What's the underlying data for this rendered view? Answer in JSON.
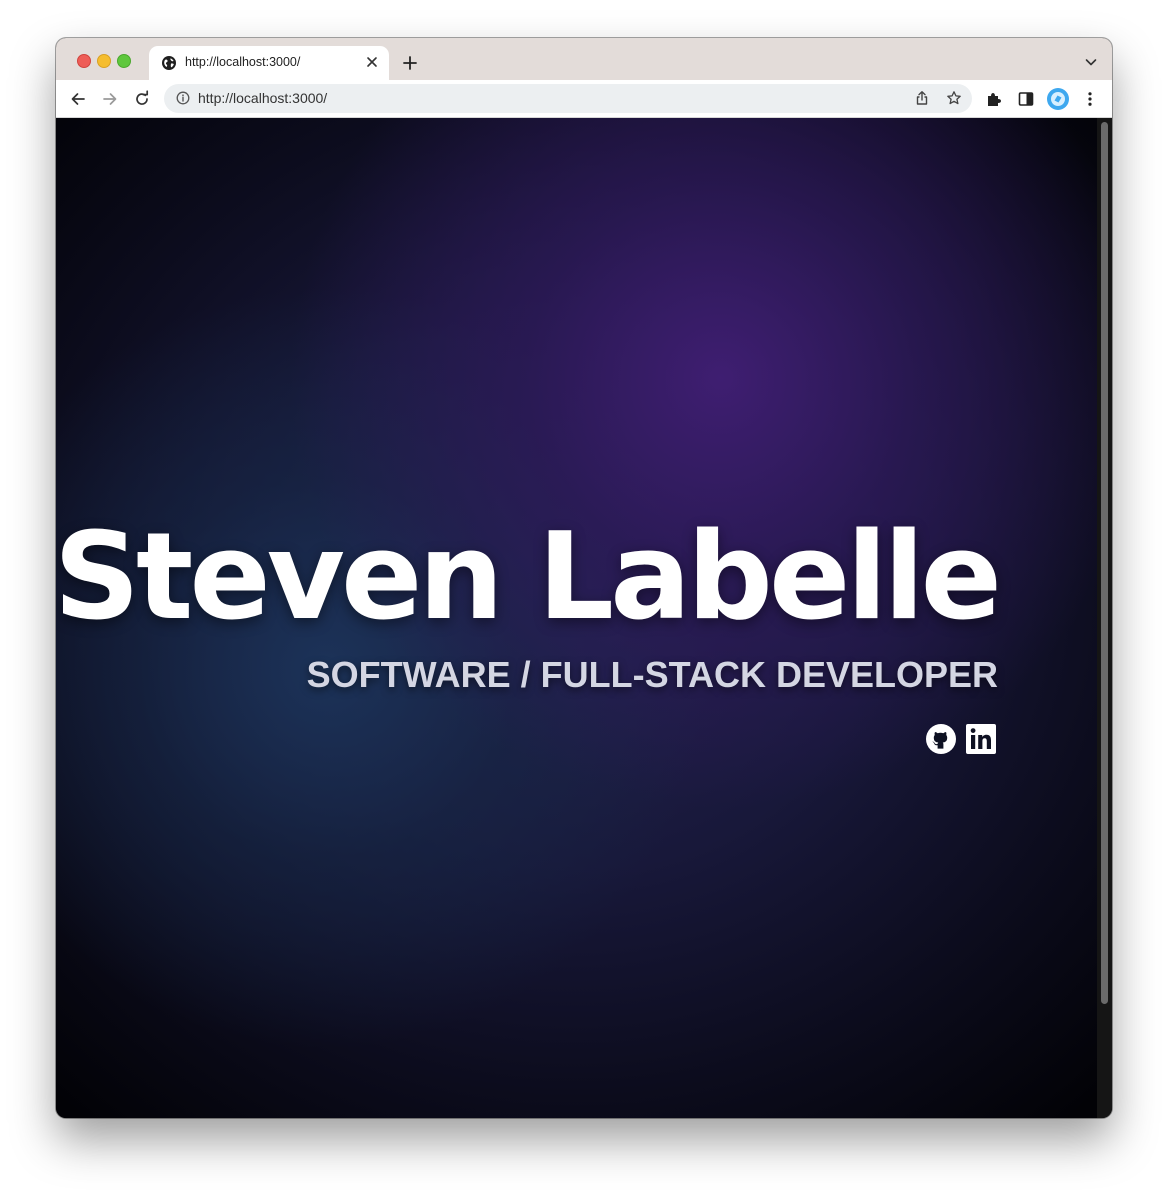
{
  "browser": {
    "tab": {
      "title": "http://localhost:3000/",
      "favicon": "globe-icon",
      "close_icon": "close-icon"
    },
    "new_tab_icon": "plus-icon",
    "tab_search_icon": "chevron-down-icon",
    "toolbar": {
      "back_icon": "back-arrow-icon",
      "forward_icon": "forward-arrow-icon",
      "reload_icon": "reload-icon",
      "extensions_icon": "puzzle-icon",
      "side_panel_icon": "side-panel-icon",
      "profile_icon": "profile-avatar-icon",
      "menu_icon": "kebab-menu-icon"
    },
    "omnibox": {
      "info_icon": "info-icon",
      "url": "http://localhost:3000/",
      "share_icon": "share-icon",
      "bookmark_icon": "star-icon"
    }
  },
  "page": {
    "name": "Steven Labelle",
    "subtitle": "SOFTWARE / FULL-STACK DEVELOPER",
    "social_links": [
      {
        "icon": "github-icon"
      },
      {
        "icon": "linkedin-icon"
      }
    ]
  },
  "colors": {
    "text_primary": "#ffffff",
    "text_subtitle": "#d4d6e3",
    "background_glow_purple": "#3e1e6e",
    "background_glow_blue": "#1c3456",
    "background_dark": "#020206"
  }
}
